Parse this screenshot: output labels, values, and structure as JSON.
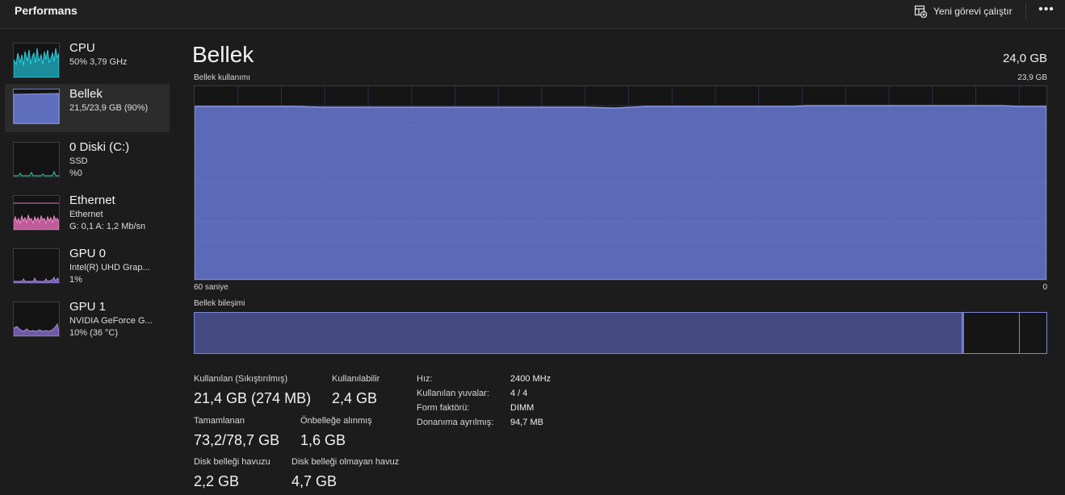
{
  "header": {
    "title": "Performans",
    "run_task_label": "Yeni görevi çalıştır",
    "more_label": "•••"
  },
  "sidebar": {
    "items": [
      {
        "name": "CPU",
        "sub1": "50%  3,79 GHz",
        "sub2": "",
        "color": "#17b7c6"
      },
      {
        "name": "Bellek",
        "sub1": "21,5/23,9 GB (90%)",
        "sub2": "",
        "color": "#6a78d6"
      },
      {
        "name": "0 Diski (C:)",
        "sub1": "SSD",
        "sub2": "%0",
        "color": "#1fa78f"
      },
      {
        "name": "Ethernet",
        "sub1": "Ethernet",
        "sub2": "G: 0,1  A: 1,2 Mb/sn",
        "color": "#e57bb8"
      },
      {
        "name": "GPU 0",
        "sub1": "Intel(R) UHD Grap...",
        "sub2": "1%",
        "color": "#9b7fd0"
      },
      {
        "name": "GPU 1",
        "sub1": "NVIDIA GeForce G...",
        "sub2": "10%  (36 °C)",
        "color": "#9b7fd0"
      }
    ]
  },
  "main": {
    "title": "Bellek",
    "total": "24,0 GB",
    "usage_label": "Bellek kullanımı",
    "usage_max": "23,9 GB",
    "time_left": "60 saniye",
    "time_right": "0",
    "composition_label": "Bellek bileşimi",
    "stats": {
      "in_use_label": "Kullanılan (Sıkıştırılmış)",
      "in_use": "21,4 GB (274 MB)",
      "available_label": "Kullanılabilir",
      "available": "2,4 GB",
      "committed_label": "Tamamlanan",
      "committed": "73,2/78,7 GB",
      "cached_label": "Önbelleğe alınmış",
      "cached": "1,6 GB",
      "paged_label": "Disk belleği havuzu",
      "paged": "2,2 GB",
      "nonpaged_label": "Disk belleği olmayan havuz",
      "nonpaged": "4,7 GB"
    },
    "details": [
      {
        "k": "Hız:",
        "v": "2400 MHz"
      },
      {
        "k": "Kullanılan yuvalar:",
        "v": "4 / 4"
      },
      {
        "k": "Form faktörü:",
        "v": "DIMM"
      },
      {
        "k": "Donanıma ayrılmış:",
        "v": "94,7 MB"
      }
    ]
  },
  "colors": {
    "memory_fill": "#5f6dbd",
    "memory_line": "#8c97e6"
  }
}
